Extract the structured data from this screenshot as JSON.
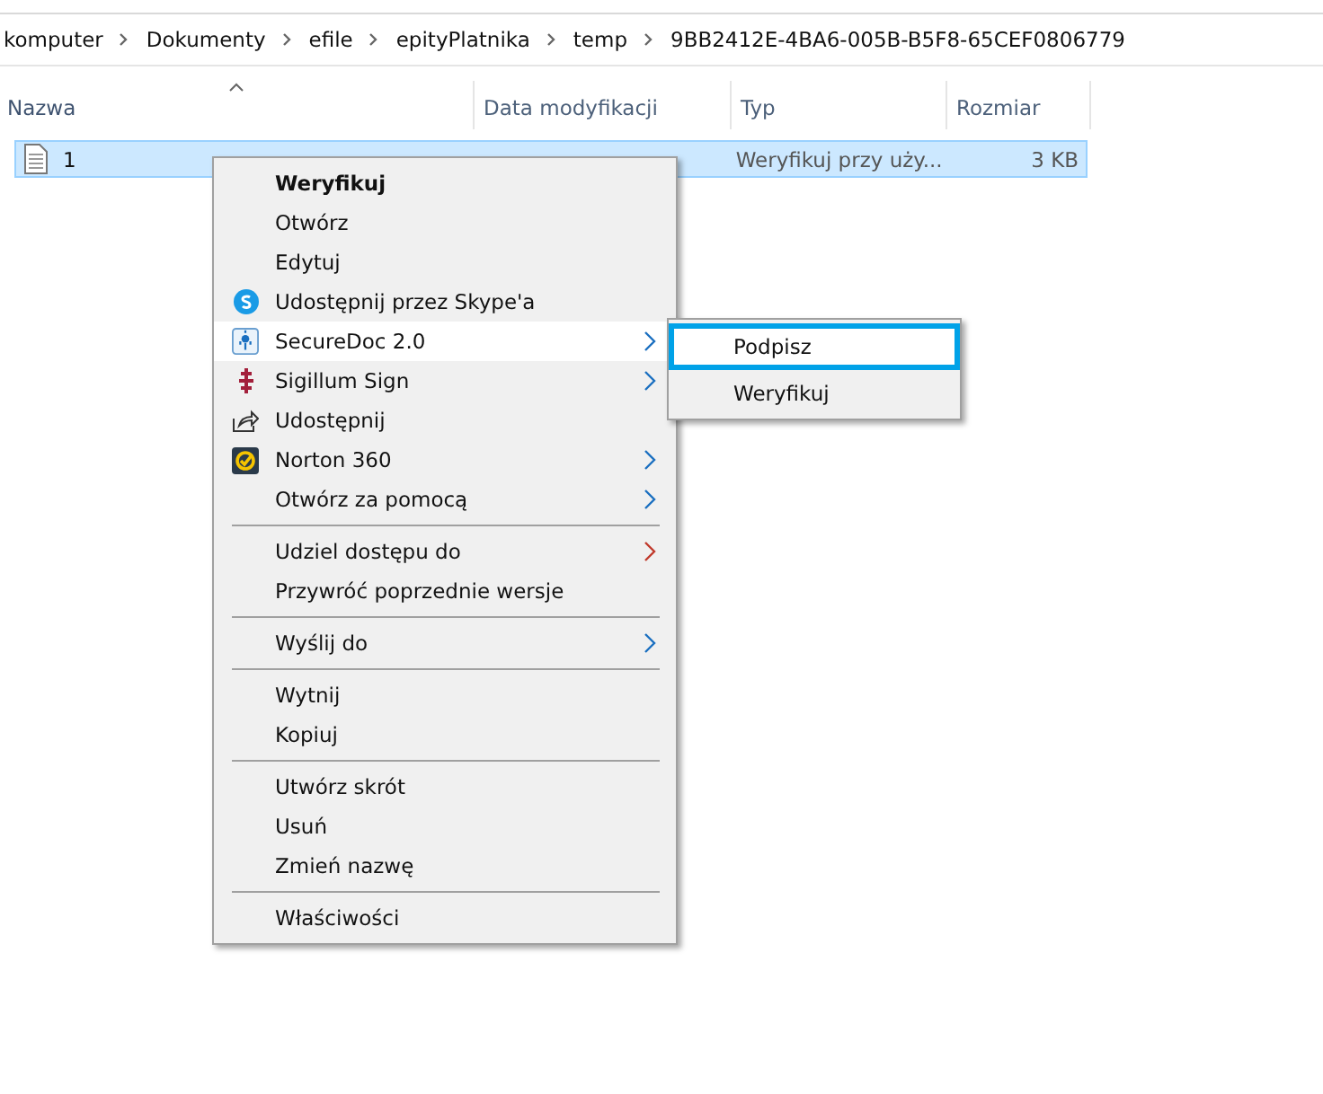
{
  "breadcrumb": [
    "komputer",
    "Dokumenty",
    "efile",
    "epityPlatnika",
    "temp",
    "9BB2412E-4BA6-005B-B5F8-65CEF0806779"
  ],
  "columns": [
    {
      "label": "Nazwa",
      "sorted": true
    },
    {
      "label": "Data modyfikacji",
      "sorted": false
    },
    {
      "label": "Typ",
      "sorted": false
    },
    {
      "label": "Rozmiar",
      "sorted": false
    }
  ],
  "files": [
    {
      "name": "1",
      "type": "Weryfikuj przy uży...",
      "size": "3 KB",
      "selected": true
    }
  ],
  "context_menu": {
    "sections": [
      [
        {
          "label": "Weryfikuj",
          "bold": true,
          "kind": "plain",
          "submenu": false,
          "selected": false
        },
        {
          "label": "Otwórz",
          "bold": false,
          "kind": "plain",
          "submenu": false,
          "selected": false
        },
        {
          "label": "Edytuj",
          "bold": false,
          "kind": "plain",
          "submenu": false,
          "selected": false
        },
        {
          "label": "Udostępnij przez Skype'a",
          "bold": false,
          "kind": "skype",
          "submenu": false,
          "selected": false
        },
        {
          "label": "SecureDoc 2.0",
          "bold": false,
          "kind": "securedoc",
          "submenu": true,
          "selected": true
        },
        {
          "label": "Sigillum Sign",
          "bold": false,
          "kind": "sigillum",
          "submenu": true,
          "selected": false
        },
        {
          "label": "Udostępnij",
          "bold": false,
          "kind": "share",
          "submenu": false,
          "selected": false
        },
        {
          "label": "Norton 360",
          "bold": false,
          "kind": "norton",
          "submenu": true,
          "selected": false
        },
        {
          "label": "Otwórz za pomocą",
          "bold": false,
          "kind": "plain",
          "submenu": true,
          "selected": false
        }
      ],
      [
        {
          "label": "Udziel dostępu do",
          "bold": false,
          "kind": "plain",
          "submenu": true,
          "selected": false
        },
        {
          "label": "Przywróć poprzednie wersje",
          "bold": false,
          "kind": "plain",
          "submenu": false,
          "selected": false
        }
      ],
      [
        {
          "label": "Wyślij do",
          "bold": false,
          "kind": "plain",
          "submenu": true,
          "selected": false
        }
      ],
      [
        {
          "label": "Wytnij",
          "bold": false,
          "kind": "plain",
          "submenu": false,
          "selected": false
        },
        {
          "label": "Kopiuj",
          "bold": false,
          "kind": "plain",
          "submenu": false,
          "selected": false
        }
      ],
      [
        {
          "label": "Utwórz skrót",
          "bold": false,
          "kind": "plain",
          "submenu": false,
          "selected": false
        },
        {
          "label": "Usuń",
          "bold": false,
          "kind": "plain",
          "submenu": false,
          "selected": false
        },
        {
          "label": "Zmień nazwę",
          "bold": false,
          "kind": "plain",
          "submenu": false,
          "selected": false
        }
      ],
      [
        {
          "label": "Właściwości",
          "bold": false,
          "kind": "plain",
          "submenu": false,
          "selected": false
        }
      ]
    ]
  },
  "submenu": {
    "items": [
      {
        "label": "Podpisz",
        "selected": true
      },
      {
        "label": "Weryfikuj",
        "selected": false
      }
    ]
  }
}
